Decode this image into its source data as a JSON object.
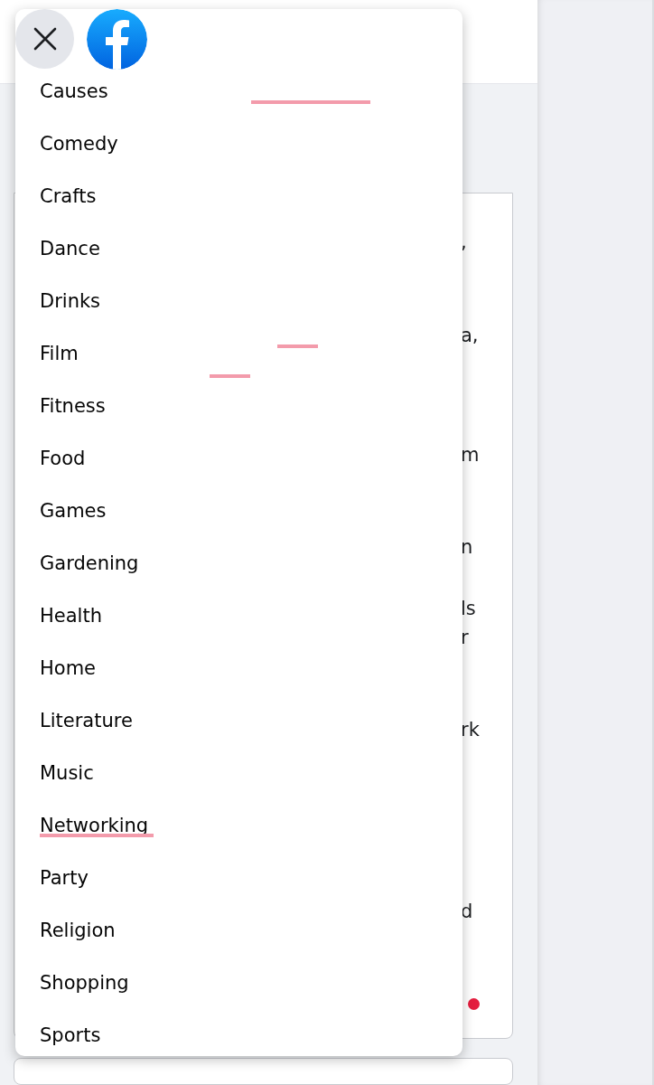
{
  "background_card": {
    "text_fragments": [
      ",",
      "a,",
      "m",
      "n",
      "ls",
      "r",
      "rk",
      "d"
    ],
    "status_dot": {
      "color": "#e41e3f"
    }
  },
  "menu": {
    "items": [
      "Causes",
      "Comedy",
      "Crafts",
      "Dance",
      "Drinks",
      "Film",
      "Fitness",
      "Food",
      "Games",
      "Gardening",
      "Health",
      "Home",
      "Literature",
      "Music",
      "Networking",
      "Party",
      "Religion",
      "Shopping",
      "Sports"
    ]
  }
}
